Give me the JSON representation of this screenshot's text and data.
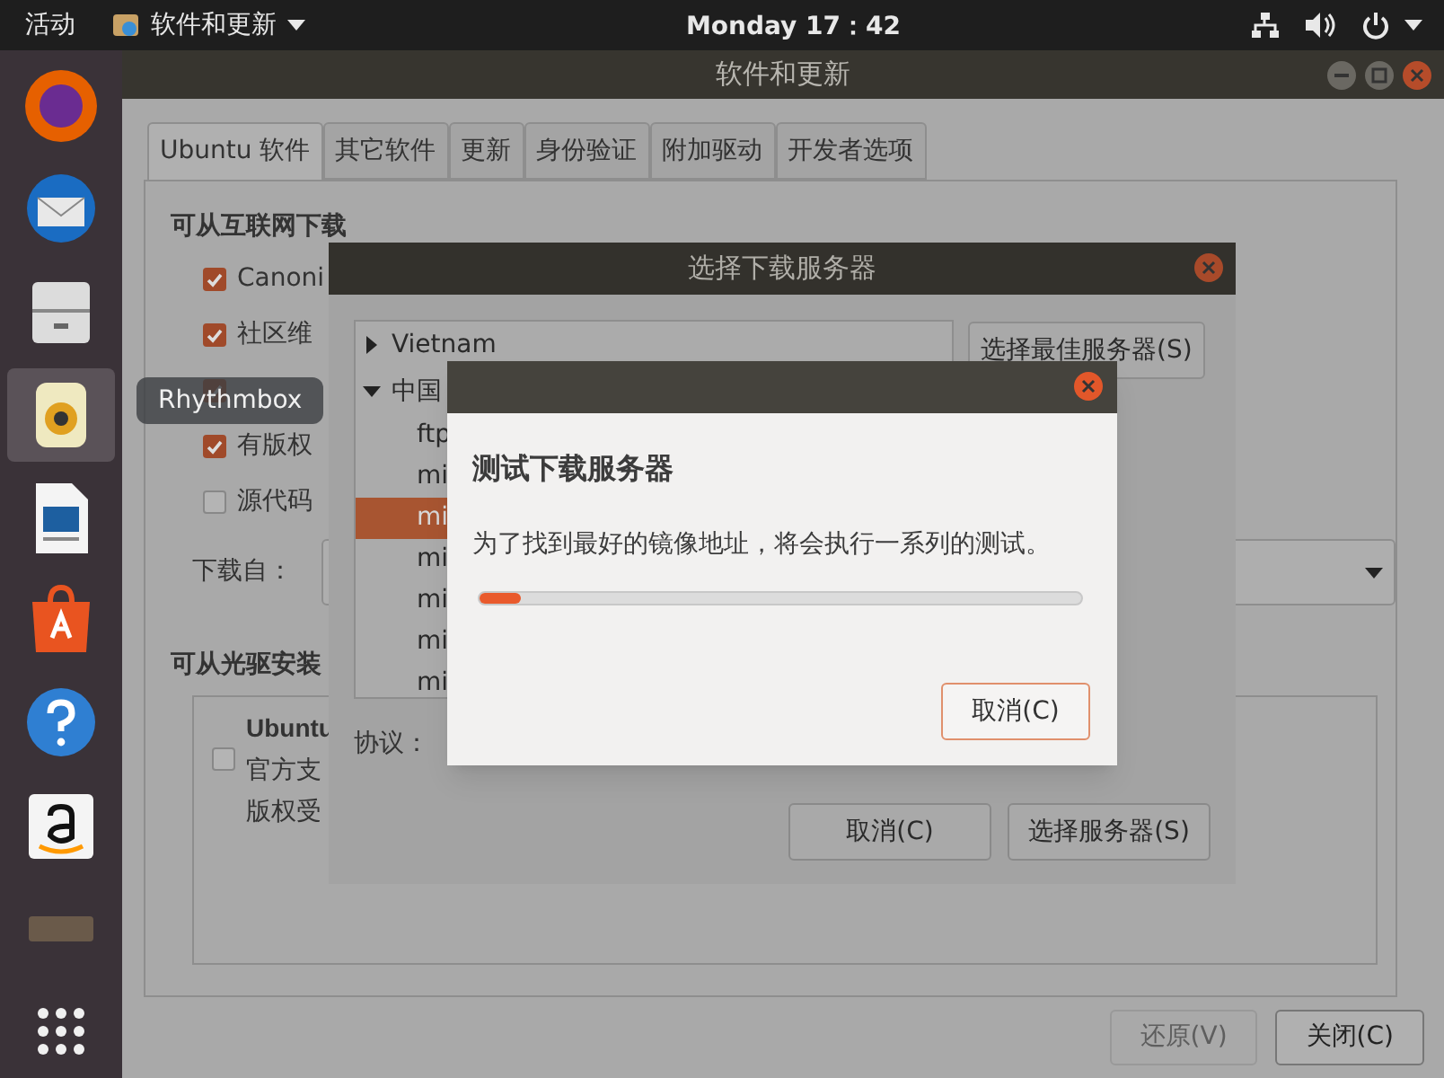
{
  "top_bar": {
    "activities": "活动",
    "app_menu": "软件和更新",
    "clock": "Monday 17：42"
  },
  "dock": [
    {
      "kind": "browser",
      "selected": false
    },
    {
      "kind": "mail",
      "selected": false
    },
    {
      "kind": "files",
      "selected": false
    },
    {
      "kind": "music",
      "selected": true
    },
    {
      "kind": "document",
      "selected": false
    },
    {
      "kind": "store",
      "selected": false
    },
    {
      "kind": "help",
      "selected": false
    },
    {
      "kind": "shop",
      "selected": false
    },
    {
      "kind": "bar",
      "selected": false
    },
    {
      "kind": "apps",
      "selected": false
    }
  ],
  "tooltip": "Rhythmbox",
  "main_window": {
    "title": "软件和更新",
    "tabs": [
      {
        "label": "Ubuntu 软件",
        "selected": true
      },
      {
        "label": "其它软件",
        "selected": false
      },
      {
        "label": "更新",
        "selected": false
      },
      {
        "label": "身份验证",
        "selected": false
      },
      {
        "label": "附加驱动",
        "selected": false
      },
      {
        "label": "开发者选项",
        "selected": false
      }
    ],
    "internet_section": {
      "heading": "可从互联网下载",
      "items": [
        {
          "label": "Canoni",
          "checked": true
        },
        {
          "label": "社区维",
          "checked": true
        },
        {
          "checked": true
        },
        {
          "label": "有版权",
          "checked": true
        },
        {
          "label": "源代码",
          "checked": false
        }
      ]
    },
    "download_from": {
      "label": "下载自："
    },
    "cdrom_section": {
      "heading": "可从光驱安装",
      "title": "Ubuntu",
      "checked": false,
      "lines": [
        "官方支",
        "版权受"
      ]
    },
    "buttons": [
      {
        "label": "还原(V)",
        "disabled": true
      },
      {
        "label": "关闭(C)",
        "disabled": false
      }
    ]
  },
  "server_dialog": {
    "title": "选择下载服务器",
    "tree": [
      {
        "label": "Vietnam",
        "expanded": false
      },
      {
        "label": "中国",
        "expanded": true,
        "children": [
          {
            "label": "ftp",
            "selected": false
          },
          {
            "label": "mi",
            "selected": false
          },
          {
            "label": "mi",
            "selected": true
          },
          {
            "label": "mi",
            "selected": false
          },
          {
            "label": "mi",
            "selected": false
          },
          {
            "label": "mi",
            "selected": false
          },
          {
            "label": "mi",
            "selected": false
          }
        ]
      }
    ],
    "best_button": "选择最佳服务器(S)",
    "protocol_label": "协议：",
    "buttons": [
      "取消(C)",
      "选择服务器(S)"
    ]
  },
  "test_dialog": {
    "heading": "测试下载服务器",
    "message": "为了找到最好的镜像地址，将会执行一系列的测试。",
    "progress": {
      "level": 0.07
    },
    "button": "取消(C)"
  }
}
